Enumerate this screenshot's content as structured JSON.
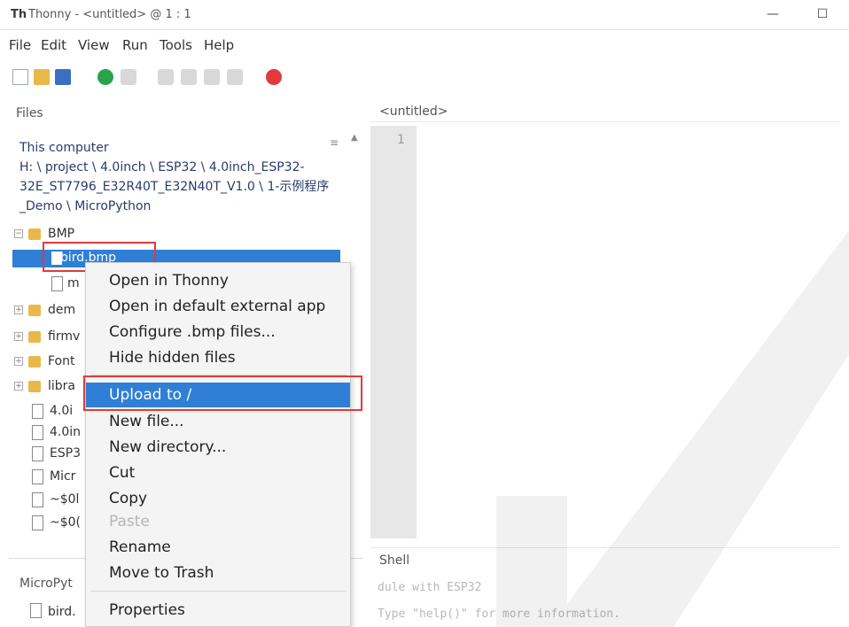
{
  "window": {
    "app_logo": "Th",
    "title": "Thonny - <untitled> @ 1 : 1",
    "minimize_label": "—",
    "maximize_label": "☐"
  },
  "menubar": [
    "File",
    "Edit",
    "View",
    "Run",
    "Tools",
    "Help"
  ],
  "toolbar_icons": [
    "new-file-icon",
    "open-folder-icon",
    "save-icon",
    "run-icon",
    "debug-icon",
    "step-over-icon",
    "step-into-icon",
    "step-out-icon",
    "resume-icon",
    "stop-icon"
  ],
  "files_panel": {
    "tab_label": "Files",
    "location_heading": "This computer",
    "path": "H: \\ project \\ 4.0inch \\ ESP32 \\ 4.0inch_ESP32-32E_ST7796_E32R40T_E32N40T_V1.0 \\ 1-示例程序_Demo \\ MicroPython",
    "tree": [
      {
        "label": "BMP",
        "type": "folder",
        "expanded": true
      },
      {
        "label": "bird.bmp",
        "type": "file",
        "selected": true
      },
      {
        "label": "m",
        "type": "file"
      },
      {
        "label": "dem",
        "type": "folder"
      },
      {
        "label": "firmv",
        "type": "folder"
      },
      {
        "label": "Font",
        "type": "folder"
      },
      {
        "label": "libra",
        "type": "folder"
      },
      {
        "label": "4.0i",
        "type": "file"
      },
      {
        "label": "4.0in",
        "type": "file"
      },
      {
        "label": "ESP3",
        "type": "file"
      },
      {
        "label": "Micr",
        "type": "file"
      },
      {
        "label": "~$0l",
        "type": "file"
      },
      {
        "label": "~$0(",
        "type": "file"
      }
    ]
  },
  "micropython_panel": {
    "tab_label": "MicroPyt",
    "first_file": "bird."
  },
  "editor": {
    "tab_label": "<untitled>",
    "line_number": "1"
  },
  "shell": {
    "tab_label": "Shell",
    "line1": "dule with ESP32",
    "line2": "Type \"help()\" for more information."
  },
  "context_menu": {
    "items": [
      {
        "label": "Open in Thonny",
        "enabled": true
      },
      {
        "label": "Open in default external app",
        "enabled": true
      },
      {
        "label": "Configure .bmp files...",
        "enabled": true
      },
      {
        "label": "Hide hidden files",
        "enabled": true
      },
      {
        "label": "Upload to /",
        "enabled": true,
        "highlighted": true
      },
      {
        "label": "New file...",
        "enabled": true
      },
      {
        "label": "New directory...",
        "enabled": true
      },
      {
        "label": "Cut",
        "enabled": true
      },
      {
        "label": "Copy",
        "enabled": true
      },
      {
        "label": "Paste",
        "enabled": false
      },
      {
        "label": "Rename",
        "enabled": true
      },
      {
        "label": "Move to Trash",
        "enabled": true
      },
      {
        "label": "Properties",
        "enabled": true
      }
    ]
  },
  "colors": {
    "selection": "#2f7fd6",
    "highlight_box": "#e23a3a",
    "gutter": "#e7e7e7"
  }
}
